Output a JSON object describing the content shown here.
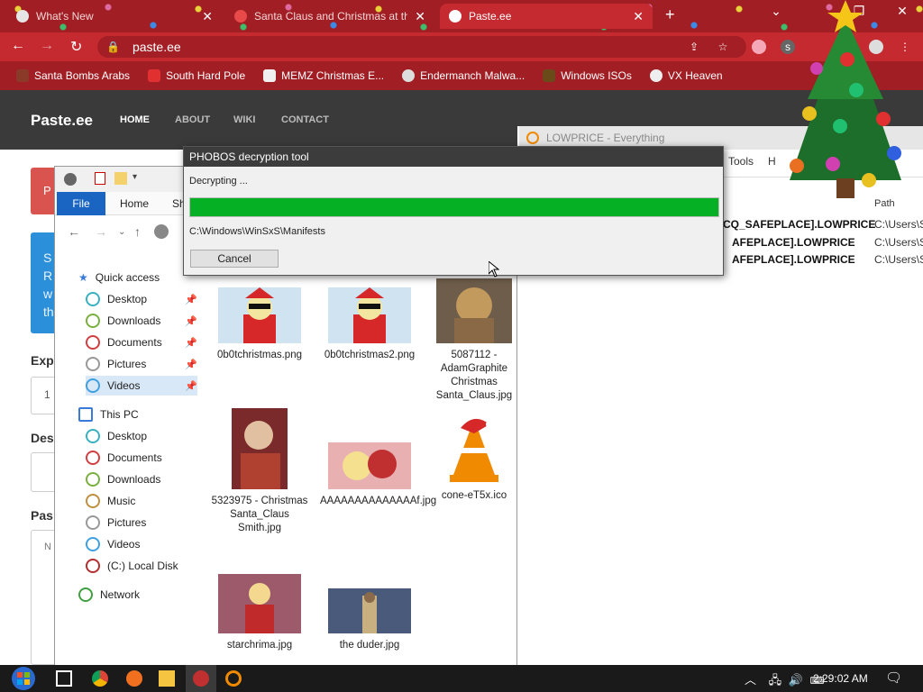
{
  "browser": {
    "tabs": [
      {
        "title": "What's New",
        "active": false
      },
      {
        "title": "Santa Claus and Christmas at the",
        "active": false
      },
      {
        "title": "Paste.ee",
        "active": true
      }
    ],
    "url": "paste.ee",
    "bookmarks": [
      "Santa Bombs Arabs",
      "South Hard Pole",
      "MEMZ Christmas E...",
      "Endermanch Malwa...",
      "Windows ISOs",
      "VX Heaven"
    ]
  },
  "page": {
    "brand": "Paste.ee",
    "nav": [
      "HOME",
      "ABOUT",
      "WIKI",
      "CONTACT"
    ],
    "red_letter": "P",
    "blue_lines": [
      "S",
      "R",
      "w",
      "th"
    ],
    "labels": [
      "Expi",
      "Des",
      "Pas"
    ],
    "box_values": [
      "1",
      "",
      "N"
    ]
  },
  "explorer": {
    "ribbon": {
      "file": "File",
      "home": "Home",
      "share": "Sh"
    },
    "tree": {
      "quick_access": "Quick access",
      "quick_items": [
        "Desktop",
        "Downloads",
        "Documents",
        "Pictures",
        "Videos"
      ],
      "this_pc": "This PC",
      "pc_items": [
        "Desktop",
        "Documents",
        "Downloads",
        "Music",
        "Pictures",
        "Videos",
        "(C:) Local Disk"
      ],
      "network": "Network"
    },
    "files": [
      {
        "name": "0b0tchristmas.png"
      },
      {
        "name": "0b0tchristmas2.png"
      },
      {
        "name": "5087112 - AdamGraphite Christmas Santa_Claus.jpg"
      },
      {
        "name": "5323975 - Christmas Santa_Claus Smith.jpg"
      },
      {
        "name": "AAAAAAAAAAAAAAf.jpg"
      },
      {
        "name": "cone-eT5x.ico"
      },
      {
        "name": "starchrima.jpg"
      },
      {
        "name": "the duder.jpg"
      }
    ]
  },
  "background_window": {
    "search": "LOWPRICE - Everything",
    "tools": "Tools",
    "tools_h": "H",
    "path_header": "Path",
    "rows": [
      {
        "name": "CQ_SAFEPLACE].LOWPRICE",
        "path": "C:\\Users\\S"
      },
      {
        "name": "AFEPLACE].LOWPRICE",
        "path": "C:\\Users\\S"
      },
      {
        "name": "AFEPLACE].LOWPRICE",
        "path": "C:\\Users\\S"
      }
    ]
  },
  "dialog": {
    "title": "PHOBOS decryption tool",
    "status": "Decrypting ...",
    "progress": 1.0,
    "path": "C:\\Windows\\WinSxS\\Manifests",
    "cancel": "Cancel"
  },
  "taskbar": {
    "time": "2:29:02 AM"
  },
  "colors": {
    "chrome_red": "#c42a30",
    "progress_green": "#06b025",
    "file_blue": "#1a65c2"
  }
}
